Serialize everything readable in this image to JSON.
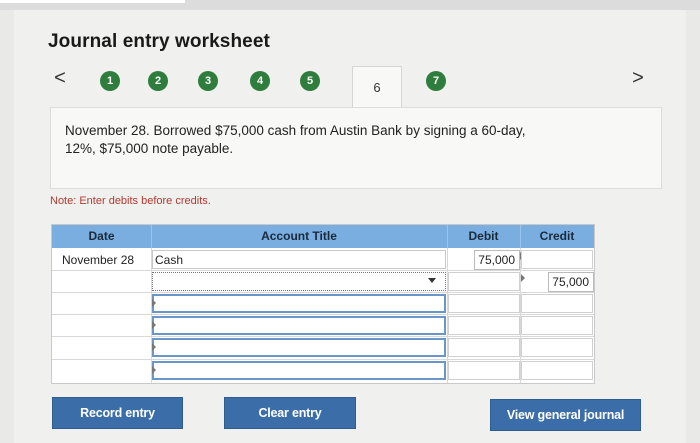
{
  "header": {
    "title": "Journal entry worksheet"
  },
  "nav": {
    "prev": "<",
    "next": ">",
    "steps": [
      "1",
      "2",
      "3",
      "4",
      "5",
      "6",
      "7"
    ],
    "active_step": "6"
  },
  "transaction": {
    "line1": "November 28. Borrowed $75,000 cash from Austin Bank by signing a 60-day,",
    "line2": "12%, $75,000 note payable."
  },
  "note": "Note: Enter debits before credits.",
  "table": {
    "headers": {
      "date": "Date",
      "account": "Account Title",
      "debit": "Debit",
      "credit": "Credit"
    },
    "rows": [
      {
        "date": "November 28",
        "account": "Cash",
        "debit": "75,000",
        "credit": ""
      },
      {
        "date": "",
        "account": "",
        "debit": "",
        "credit": "75,000"
      },
      {
        "date": "",
        "account": "",
        "debit": "",
        "credit": ""
      },
      {
        "date": "",
        "account": "",
        "debit": "",
        "credit": ""
      },
      {
        "date": "",
        "account": "",
        "debit": "",
        "credit": ""
      },
      {
        "date": "",
        "account": "",
        "debit": "",
        "credit": ""
      }
    ]
  },
  "buttons": {
    "record": "Record entry",
    "clear": "Clear entry",
    "view_journal": "View general journal"
  },
  "colors": {
    "step_green": "#2e7d3c",
    "header_blue": "#7aaee0",
    "button_blue": "#3b6ea8",
    "note_red": "#b03a2e"
  }
}
